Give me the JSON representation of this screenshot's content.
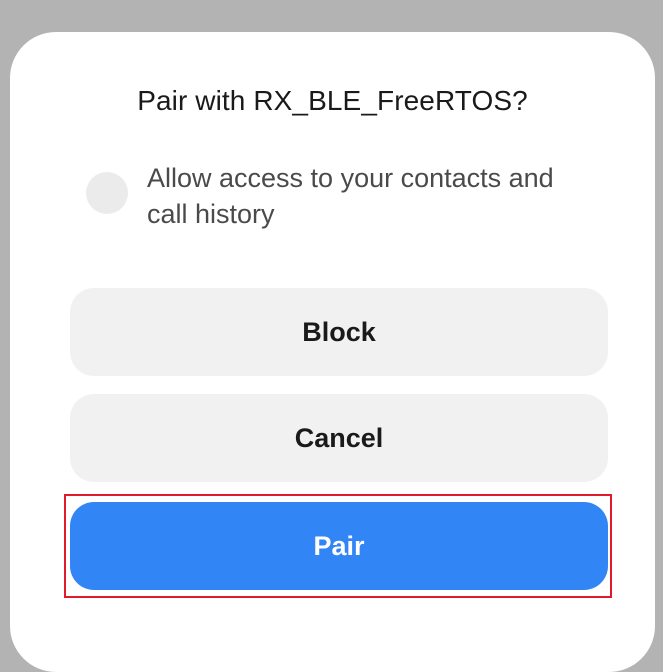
{
  "dialog": {
    "title": "Pair with RX_BLE_FreeRTOS?",
    "checkbox": {
      "label": "Allow access to your contacts and call history",
      "checked": false
    },
    "buttons": {
      "block_label": "Block",
      "cancel_label": "Cancel",
      "pair_label": "Pair"
    }
  },
  "colors": {
    "primary": "#3285f5",
    "highlight": "#e01b2b"
  }
}
